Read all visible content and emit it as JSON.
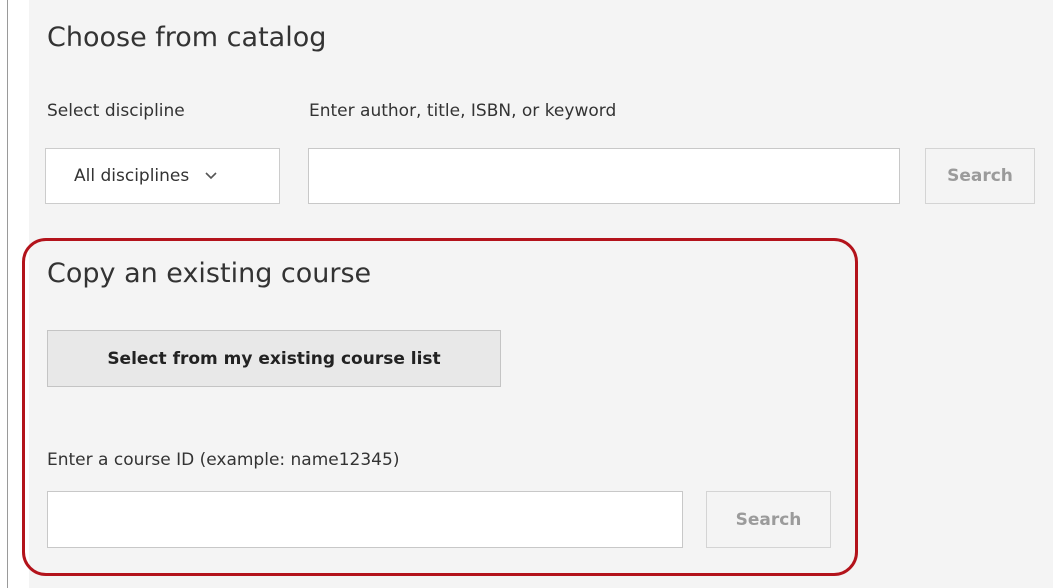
{
  "catalog": {
    "title": "Choose from catalog",
    "discipline_label": "Select discipline",
    "discipline_selected": "All disciplines",
    "keyword_label": "Enter author, title, ISBN, or keyword",
    "keyword_value": "",
    "search_label": "Search"
  },
  "copy_course": {
    "title": "Copy an existing course",
    "select_button_label": "Select from my existing course list",
    "course_id_label": "Enter a course ID (example: name12345)",
    "course_id_value": "",
    "search_label": "Search"
  },
  "icons": {
    "dropdown": "chevron-down-icon"
  },
  "colors": {
    "highlight": "#b3131b",
    "panel_background": "#f4f4f4",
    "disabled_text": "#9b9b9b"
  }
}
